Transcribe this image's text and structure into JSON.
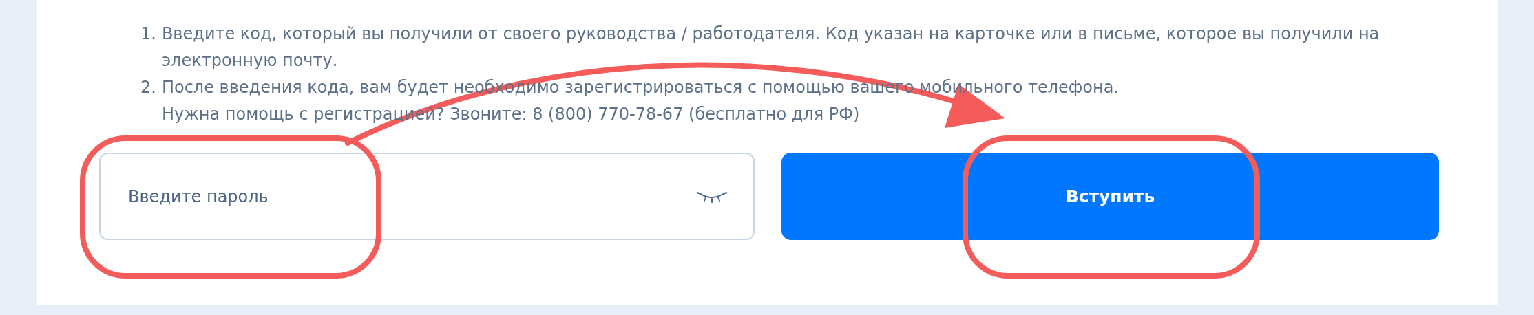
{
  "instructions": [
    {
      "number": "1.",
      "text": "Введите код, который вы получили от своего руководства / работодателя. Код указан на карточке или в письме, которое вы получили на электронную почту."
    },
    {
      "number": "2.",
      "text": "После введения кода, вам будет необходимо зарегистрироваться с помощью вашего мобильного телефона.",
      "note": "Нужна помощь с регистрацией? Звоните: 8 (800) 770-78-67 (бесплатно для РФ)"
    }
  ],
  "password_field": {
    "placeholder": "Введите пароль"
  },
  "submit_button": {
    "label": "Вступить"
  },
  "annotations": [
    {
      "kind": "ring"
    },
    {
      "kind": "ring"
    },
    {
      "kind": "arrow"
    }
  ]
}
